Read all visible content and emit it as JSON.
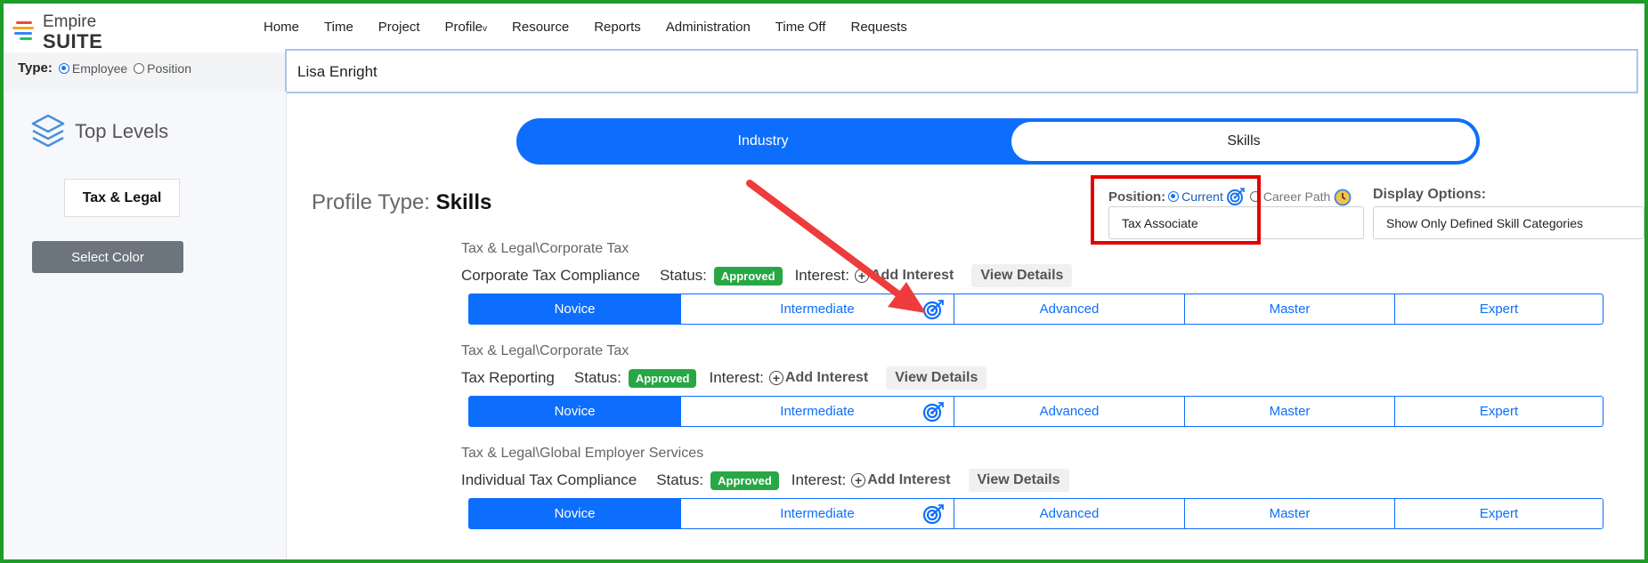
{
  "app": {
    "logo_line1": "Empire",
    "logo_line2": "SUITE"
  },
  "nav": [
    {
      "label": "Home"
    },
    {
      "label": "Time"
    },
    {
      "label": "Project"
    },
    {
      "label": "Profile",
      "caret": "v"
    },
    {
      "label": "Resource"
    },
    {
      "label": "Reports"
    },
    {
      "label": "Administration"
    },
    {
      "label": "Time Off"
    },
    {
      "label": "Requests"
    }
  ],
  "type_selector": {
    "label": "Type:",
    "options": [
      "Employee",
      "Position"
    ],
    "selected": "Employee"
  },
  "search": {
    "value": "Lisa Enright"
  },
  "sidebar": {
    "title": "Top Levels",
    "selected_level": "Tax & Legal",
    "select_color_label": "Select Color"
  },
  "toggle": {
    "left": "Industry",
    "right": "Skills",
    "active": "Skills"
  },
  "profile_type": {
    "label": "Profile Type:",
    "value": "Skills"
  },
  "position": {
    "label": "Position:",
    "option_current": "Current",
    "option_career": "Career Path",
    "value": "Tax Associate"
  },
  "display_options": {
    "label": "Display Options:",
    "value": "Show Only Defined Skill Categories"
  },
  "skills": [
    {
      "path": "Tax & Legal\\Corporate Tax",
      "name": "Corporate Tax Compliance",
      "status_label": "Status:",
      "status": "Approved",
      "interest_label": "Interest:",
      "add_interest": "Add Interest",
      "view_details": "View Details",
      "levels": [
        "Novice",
        "Intermediate",
        "Advanced",
        "Master",
        "Expert"
      ]
    },
    {
      "path": "Tax & Legal\\Corporate Tax",
      "name": "Tax Reporting",
      "status_label": "Status:",
      "status": "Approved",
      "interest_label": "Interest:",
      "add_interest": "Add Interest",
      "view_details": "View Details",
      "levels": [
        "Novice",
        "Intermediate",
        "Advanced",
        "Master",
        "Expert"
      ]
    },
    {
      "path": "Tax & Legal\\Global Employer Services",
      "name": "Individual Tax Compliance",
      "status_label": "Status:",
      "status": "Approved",
      "interest_label": "Interest:",
      "add_interest": "Add Interest",
      "view_details": "View Details",
      "levels": [
        "Novice",
        "Intermediate",
        "Advanced",
        "Master",
        "Expert"
      ]
    }
  ],
  "colors": {
    "primary": "#0d6efd",
    "approved": "#28a745",
    "annotation": "#e30000",
    "frame": "#1e9c2a"
  }
}
